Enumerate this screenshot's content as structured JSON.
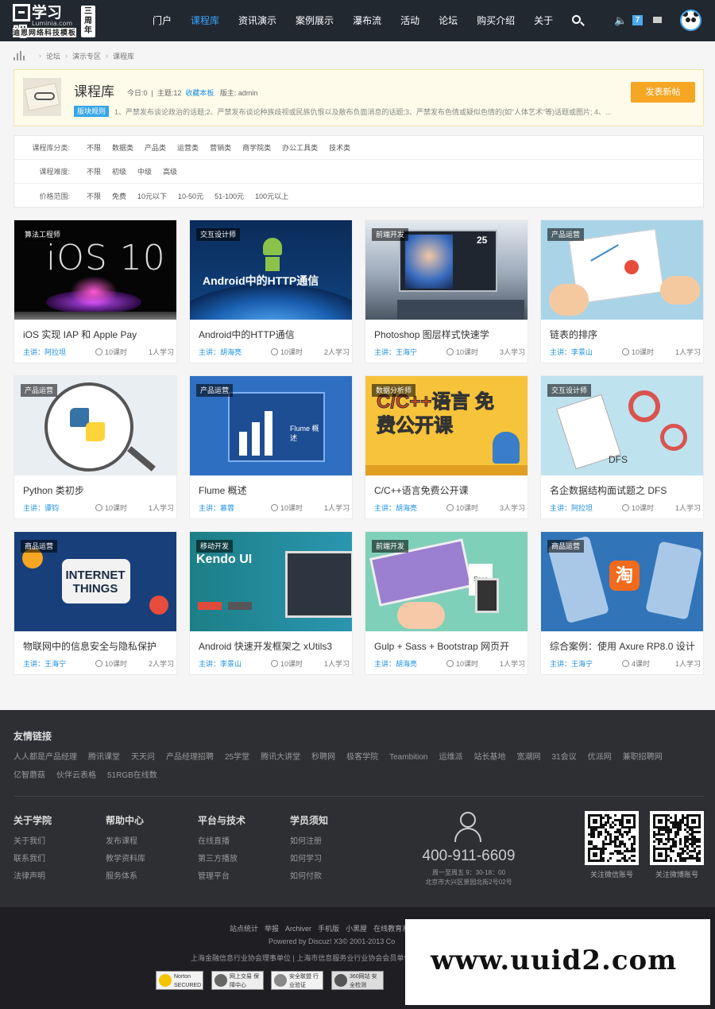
{
  "header": {
    "logo_main": "学习吧",
    "logo_domain": "Luminia.com",
    "logo_sub": "迪恩网络科技模板",
    "logo_badge": "三周年",
    "nav": [
      "门户",
      "课程库",
      "资讯演示",
      "案例展示",
      "瀑布流",
      "活动",
      "论坛",
      "购买介绍",
      "关于"
    ],
    "active_nav": "课程库",
    "notif_count": "7"
  },
  "breadcrumb": [
    "论坛",
    "演示专区",
    "课程库"
  ],
  "forum": {
    "title": "课程库",
    "today": "今日:0",
    "topics": "主题:12",
    "favorite": "收藏本板",
    "moderator": "版主: admin",
    "rules_badge": "版块规则",
    "rules_text": "1、严禁发布谈论政治的话题;2、严禁发布谈论种族歧视或民族仇恨以及散布负面消息的话题;3、严禁发布色情或疑似色情的(如“人体艺术”等)话题或图片; 4、...",
    "post_button": "发表新帖"
  },
  "filters": [
    {
      "label": "课程库分类:",
      "options": [
        "不限",
        "数据类",
        "产品类",
        "运营类",
        "营销类",
        "商学院类",
        "办公工具类",
        "技术类"
      ]
    },
    {
      "label": "课程难度:",
      "options": [
        "不限",
        "初级",
        "中级",
        "高级"
      ]
    },
    {
      "label": "价格范围:",
      "options": [
        "不限",
        "免费",
        "10元以下",
        "10-50元",
        "51-100元",
        "100元以上"
      ]
    }
  ],
  "courses": [
    {
      "tag": "算法工程师",
      "title": "iOS 实现 IAP 和 Apple Pay",
      "lecturer": "主讲：阿拉坦",
      "hours": "10课时",
      "students": "1人学习",
      "img_text": "iOS 10"
    },
    {
      "tag": "交互设计师",
      "title": "Android中的HTTP通信",
      "lecturer": "主讲：胡海亮",
      "hours": "10课时",
      "students": "2人学习",
      "img_text": "Android中的HTTP通信"
    },
    {
      "tag": "前端开发",
      "title": "Photoshop 图层样式快速学",
      "lecturer": "主讲：王海宁",
      "hours": "10课时",
      "students": "3人学习",
      "img_text": "25"
    },
    {
      "tag": "产品运营",
      "title": "链表的排序",
      "lecturer": "主讲：李景山",
      "hours": "10课时",
      "students": "1人学习",
      "img_text": ""
    },
    {
      "tag": "产品运营",
      "title": "Python 类初步",
      "lecturer": "主讲：谭钧",
      "hours": "10课时",
      "students": "1人学习",
      "img_text": ""
    },
    {
      "tag": "产品运营",
      "title": "Flume 概述",
      "lecturer": "主讲：慕蓉",
      "hours": "10课时",
      "students": "1人学习",
      "img_text": "Flume 概述"
    },
    {
      "tag": "数据分析师",
      "title": "C/C++语言免费公开课",
      "lecturer": "主讲：胡海亮",
      "hours": "10课时",
      "students": "3人学习",
      "img_text": "C/C++语言 免费公开课"
    },
    {
      "tag": "交互设计师",
      "title": "名企数据结构面试题之 DFS",
      "lecturer": "主讲：阿拉坦",
      "hours": "10课时",
      "students": "1人学习",
      "img_text": "DFS"
    },
    {
      "tag": "商品运营",
      "title": "物联网中的信息安全与隐私保护",
      "lecturer": "主讲：王海宁",
      "hours": "10课时",
      "students": "2人学习",
      "img_text": "INTERNET THINGS"
    },
    {
      "tag": "移动开发",
      "title": "Android 快速开发框架之 xUtils3",
      "lecturer": "主讲：李景山",
      "hours": "10课时",
      "students": "1人学习",
      "img_text": "Kendo UI"
    },
    {
      "tag": "前端开发",
      "title": "Gulp + Sass + Bootstrap 网页开",
      "lecturer": "主讲：胡海亮",
      "hours": "10课时",
      "students": "1人学习",
      "img_text": "Sass"
    },
    {
      "tag": "商品运营",
      "title": "综合案例：使用 Axure RP8.0 设计",
      "lecturer": "主讲：王海宁",
      "hours": "4课时",
      "students": "1人学习",
      "img_text": "淘"
    }
  ],
  "footer": {
    "friends_title": "友情链接",
    "friends": [
      "人人都是产品经理",
      "腾讯课堂",
      "天天问",
      "产品经理招聘",
      "25学堂",
      "腾讯大讲堂",
      "秒聘网",
      "极客学院",
      "Teambition",
      "运维派",
      "站长基地",
      "宽潮网",
      "31会议",
      "优派网",
      "兼职招聘网",
      "亿智蘑菇",
      "伙伴云表格",
      "51RGB在线数"
    ],
    "columns": [
      {
        "title": "关于学院",
        "links": [
          "关于我们",
          "联系我们",
          "法律声明"
        ]
      },
      {
        "title": "帮助中心",
        "links": [
          "发布课程",
          "教学资料库",
          "服务体系"
        ]
      },
      {
        "title": "平台与技术",
        "links": [
          "在线直播",
          "第三方播放",
          "管理平台"
        ]
      },
      {
        "title": "学员须知",
        "links": [
          "如何注册",
          "如何学习",
          "如何付款"
        ]
      }
    ],
    "phone": "400-911-6609",
    "hours": "周一至周五 9：30-18：00",
    "address": "北京市大兴区景园北街2号02号",
    "qr_labels": [
      "关注微信账号",
      "关注微博账号"
    ]
  },
  "bottom": {
    "links": [
      "站点统计",
      "举报",
      "Archiver",
      "手机版",
      "小黑屋",
      "在线教育系"
    ],
    "powered": "Powered by Discuz!  X3© 2001-2013 Co",
    "orgs": "上海金融信息行业协会理事单位 | 上海市信息服务业行业协会会员单位",
    "certs": [
      "Norton SECURED",
      "网上交易 保障中心",
      "安全联盟 行业验证",
      "360网站 安全检测"
    ],
    "watermark": "www.uuid2.com"
  }
}
